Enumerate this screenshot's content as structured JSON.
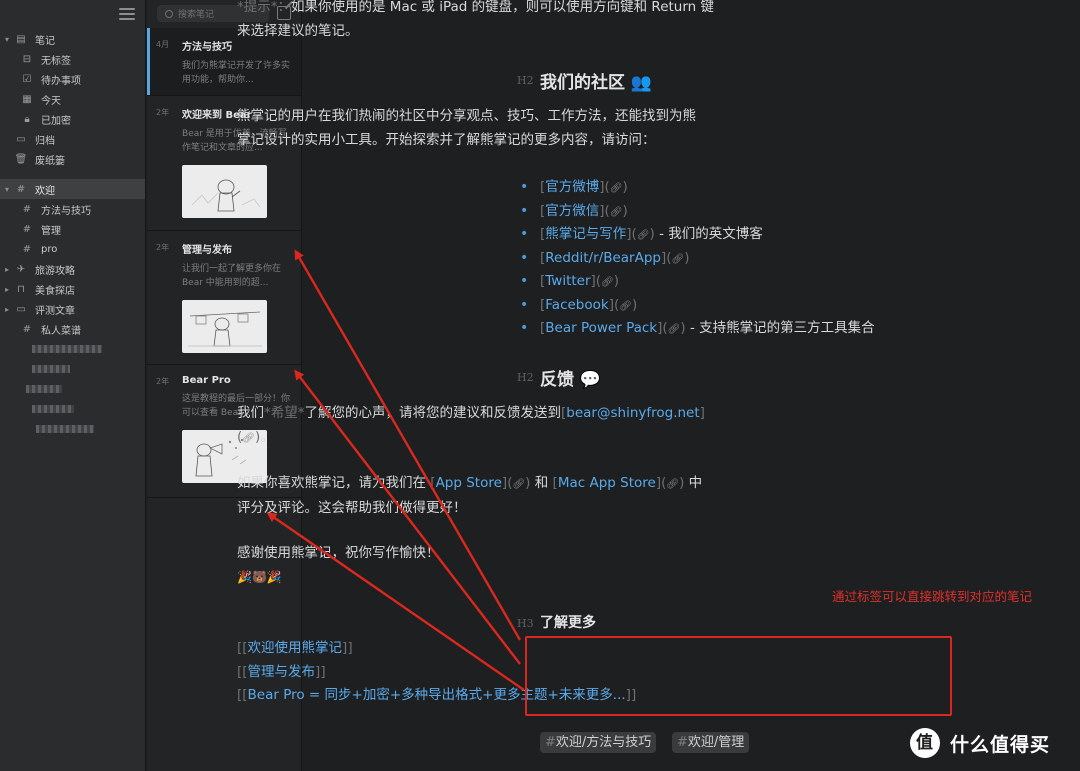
{
  "sidebar": {
    "system": [
      {
        "label": "笔记",
        "icon": "notes-icon"
      },
      {
        "label": "无标签",
        "icon": "untagged-icon"
      },
      {
        "label": "待办事项",
        "icon": "todo-icon"
      },
      {
        "label": "今天",
        "icon": "calendar-icon"
      },
      {
        "label": "已加密",
        "icon": "lock-icon"
      },
      {
        "label": "归档",
        "icon": "archive-icon"
      },
      {
        "label": "废纸篓",
        "icon": "trash-icon"
      }
    ],
    "tags": [
      {
        "label": "欢迎",
        "icon": "hash-icon"
      },
      {
        "label": "方法与技巧",
        "icon": "hash-icon"
      },
      {
        "label": "管理",
        "icon": "hash-icon"
      },
      {
        "label": "pro",
        "icon": "hash-icon"
      },
      {
        "label": "旅游攻略",
        "icon": "airplane-icon"
      },
      {
        "label": "美食探店",
        "icon": "bag-icon"
      },
      {
        "label": "评测文章",
        "icon": "laptop-icon"
      },
      {
        "label": "私人菜谱",
        "icon": "hash-icon"
      }
    ]
  },
  "notelist": {
    "search_placeholder": "搜索笔记",
    "notes": [
      {
        "age": "4月",
        "title": "方法与技巧",
        "snippet": "我们为熊掌记开发了许多实用功能，帮助你..."
      },
      {
        "age": "2年",
        "title": "欢迎来到 Bear",
        "snippet": "Bear 是用于优美、流畅写作笔记和文章的应..."
      },
      {
        "age": "2年",
        "title": "管理与发布",
        "snippet": "让我们一起了解更多你在 Bear 中能用到的超..."
      },
      {
        "age": "2年",
        "title": "Bear Pro",
        "snippet": "这是教程的最后一部分！你可以查看 Bear..."
      }
    ]
  },
  "editor": {
    "tip_line1_pre": "*提示*：",
    "tip_line1": "如果你使用的是 Mac 或 iPad 的键盘，则可以使用方向键和 Return 键",
    "tip_line2": "来选择建议的笔记。",
    "h2_mark": "H2",
    "h3_mark": "H3",
    "community_title": "我们的社区 👥",
    "community_p1": "熊掌记的用户在我们热闹的社区中分享观点、技巧、工作方法，还能找到为熊",
    "community_p2": "掌记设计的实用小工具。开始探索并了解熊掌记的更多内容，请访问：",
    "links": [
      {
        "text": "官方微博",
        "suffix": ""
      },
      {
        "text": "官方微信",
        "suffix": ""
      },
      {
        "text": "熊掌记与写作",
        "suffix": " - 我们的英文博客"
      },
      {
        "text": "Reddit/r/BearApp",
        "suffix": ""
      },
      {
        "text": "Twitter",
        "suffix": ""
      },
      {
        "text": "Facebook",
        "suffix": ""
      },
      {
        "text": "Bear Power Pack",
        "suffix": " - 支持熊掌记的第三方工具集合"
      }
    ],
    "feedback_title": "反馈 💬",
    "fb_p1_a": "我们",
    "fb_p1_b": "*希望*",
    "fb_p1_c": "了解您的心声，请将您的建议和反馈发送到",
    "fb_email": "bear@shinyfrog.net",
    "fb_p2_end": "。",
    "fb_p3_a": "如果你喜欢熊掌记，请为我们在",
    "fb_appstore": "App Store",
    "fb_and": " 和 ",
    "fb_macappstore": "Mac App Store",
    "fb_p3_b": " 中",
    "fb_p4": "评分及评论。这会帮助我们做得更好！",
    "thanks": "感谢使用熊掌记，祝你写作愉快！",
    "thanks_emoji": "🎉🐻🎉",
    "more_title": "了解更多",
    "wikilinks": [
      "欢迎使用熊掌记",
      "管理与发布",
      "Bear Pro = 同步+加密+多种导出格式+更多主题+未来更多..."
    ],
    "tags": [
      "欢迎/方法与技巧",
      "欢迎/管理"
    ]
  },
  "annotation": {
    "text": "通过标签可以直接跳转到对应的笔记",
    "color": "#e0302a"
  },
  "watermark": {
    "logo": "值",
    "text": "什么值得买"
  },
  "colors": {
    "link": "#5aaaea",
    "accent": "#5aa6dd",
    "annotation": "#d9281e",
    "background": "#1e1f21"
  }
}
